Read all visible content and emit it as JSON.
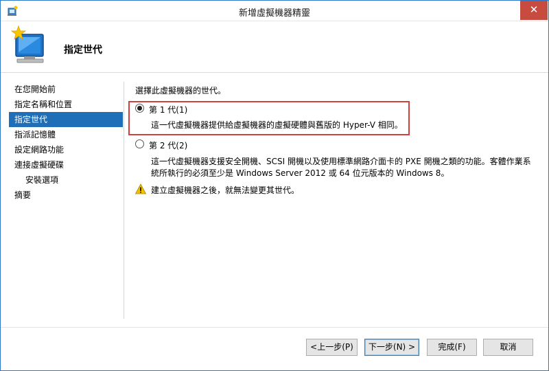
{
  "window": {
    "title": "新增虛擬機器精靈",
    "close_glyph": "✕"
  },
  "header": {
    "title": "指定世代"
  },
  "nav": {
    "items": [
      {
        "label": "在您開始前"
      },
      {
        "label": "指定名稱和位置"
      },
      {
        "label": "指定世代",
        "active": true
      },
      {
        "label": "指派記憶體"
      },
      {
        "label": "設定網路功能"
      },
      {
        "label": "連接虛擬硬碟"
      },
      {
        "label": "安裝選項",
        "sub": true
      },
      {
        "label": "摘要"
      }
    ]
  },
  "main": {
    "intro": "選擇此虛擬機器的世代。",
    "options": [
      {
        "label": "第 1 代(1)",
        "selected": true,
        "description": "這一代虛擬機器提供給虛擬機器的虛擬硬體與舊版的 Hyper-V 相同。"
      },
      {
        "label": "第 2 代(2)",
        "selected": false,
        "description": "這一代虛擬機器支援安全開機、SCSI 開機以及使用標準網路介面卡的 PXE 開機之類的功能。客體作業系統所執行的必須至少是 Windows Server 2012 或 64 位元版本的 Windows 8。"
      }
    ],
    "warning": "建立虛擬機器之後，就無法變更其世代。"
  },
  "buttons": {
    "prev": "<上一步(P)",
    "next": "下一步(N) >",
    "finish": "完成(F)",
    "cancel": "取消"
  },
  "colors": {
    "accent": "#1e6fb7",
    "highlight_border": "#d2403e",
    "close": "#c74b3f",
    "warning": "#f2c200"
  },
  "icons": {
    "app": "hyper-v-icon",
    "header": "new-vm-icon",
    "warning": "warning-icon",
    "close": "close-icon"
  }
}
